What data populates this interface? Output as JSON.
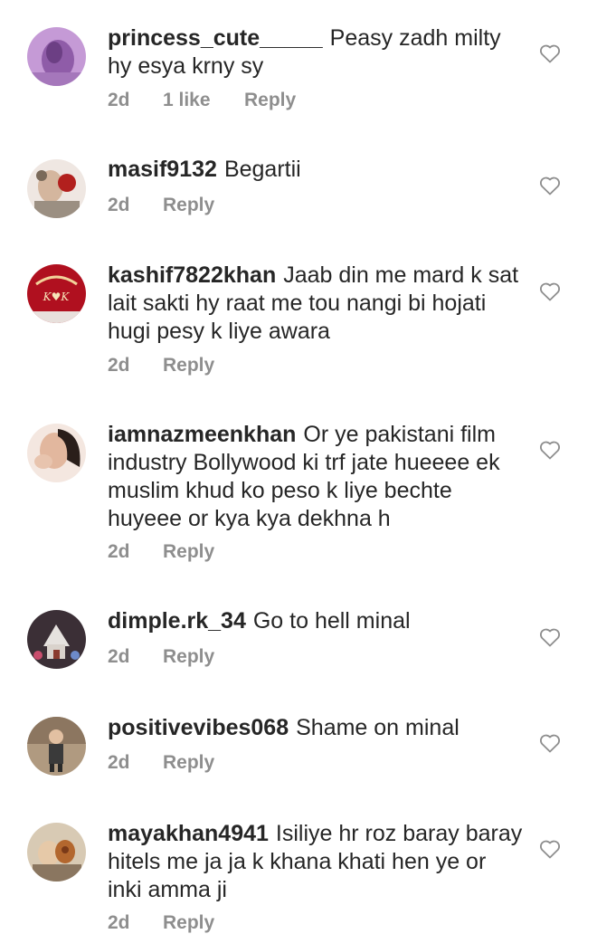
{
  "comments": [
    {
      "username": "princess_cute_____",
      "text": "Peasy zadh milty hy esya krny sy",
      "age": "2d",
      "likes": "1 like",
      "reply": "Reply",
      "avatar_color": "#b689c9"
    },
    {
      "username": "masif9132",
      "text": "Begartii",
      "age": "2d",
      "likes": "",
      "reply": "Reply",
      "avatar_color": "#d9c5b5"
    },
    {
      "username": "kashif7822khan",
      "text": "Jaab din me mard k sat lait sakti hy raat me tou nangi bi hojati hugi pesy k liye awara",
      "age": "2d",
      "likes": "",
      "reply": "Reply",
      "avatar_color": "#c0142c"
    },
    {
      "username": "iamnazmeenkhan",
      "text": "Or ye pakistani  film industry Bollywood ki trf jate hueeee ek muslim khud ko peso k liye bechte huyeee or kya kya dekhna h",
      "age": "2d",
      "likes": "",
      "reply": "Reply",
      "avatar_color": "#e8c3ad"
    },
    {
      "username": "dimple.rk_34",
      "text": "Go to hell minal",
      "age": "2d",
      "likes": "",
      "reply": "Reply",
      "avatar_color": "#5a4a54"
    },
    {
      "username": "positivevibes068",
      "text": "Shame on minal",
      "age": "2d",
      "likes": "",
      "reply": "Reply",
      "avatar_color": "#a08a72"
    },
    {
      "username": "mayakhan4941",
      "text": "Isiliye hr roz baray baray hitels me ja ja k khana khati hen ye or inki amma ji",
      "age": "2d",
      "likes": "",
      "reply": "Reply",
      "avatar_color": "#c7b59d"
    }
  ],
  "colors": {
    "text": "#262626",
    "meta": "#8e8e8e",
    "heart_stroke": "#8e8e8e"
  },
  "icons": {
    "like": "heart-outline-icon"
  }
}
